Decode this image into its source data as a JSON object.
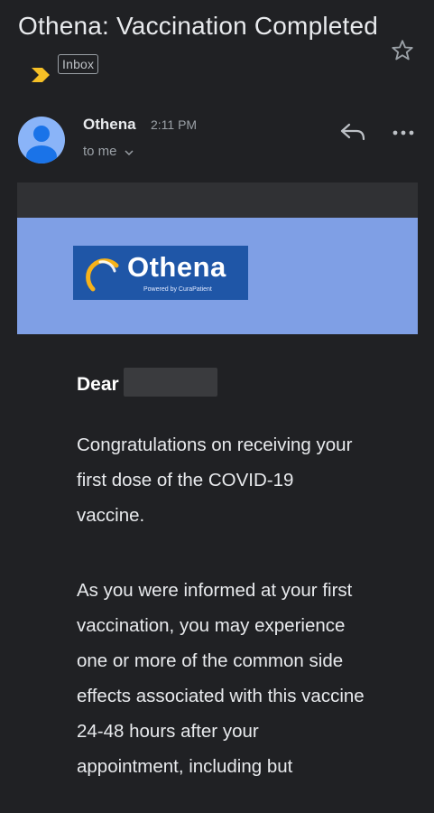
{
  "email": {
    "subject": "Othena: Vaccination Completed",
    "label": "Inbox",
    "sender": "Othena",
    "time": "2:11 PM",
    "recipient": "to me",
    "colors": {
      "background": "#202124",
      "banner_blue": "#7f9fe5",
      "logo_blue": "#1f56a7",
      "importance_marker": "#f6c026",
      "avatar": "#8ab4f8"
    }
  },
  "logo": {
    "wordmark": "Othena",
    "tagline": "Powered by CuraPatient"
  },
  "body": {
    "greeting": "Dear",
    "paragraph1": "Congratulations on receiving your first dose of the COVID-19 vaccine.",
    "paragraph2": "As you were informed at your first vaccination, you may experience one or more of the common side effects associated with this vaccine 24-48 hours after your appointment, including but"
  }
}
